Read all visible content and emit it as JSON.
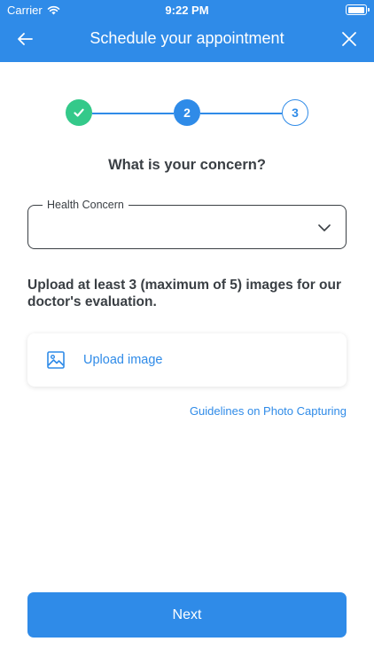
{
  "status_bar": {
    "carrier": "Carrier",
    "time": "9:22 PM",
    "battery_level": 1.0
  },
  "header": {
    "title": "Schedule your appointment",
    "back_icon": "arrow-left-icon",
    "close_icon": "close-icon",
    "background_color": "#2f8be8"
  },
  "stepper": {
    "steps": [
      {
        "label": "",
        "state": "completed",
        "icon": "checkmark-icon"
      },
      {
        "label": "2",
        "state": "current"
      },
      {
        "label": "3",
        "state": "upcoming"
      }
    ],
    "completed_color": "#34c98a",
    "active_color": "#2f8be8"
  },
  "question": "What is your concern?",
  "concern_field": {
    "label": "Health Concern",
    "value": "",
    "icon": "chevron-down-icon"
  },
  "upload": {
    "instructions": "Upload at least 3 (maximum of 5) images for our doctor's evaluation.",
    "button_label": "Upload image",
    "icon": "image-icon"
  },
  "guidelines_link": "Guidelines on Photo Capturing",
  "next_button": "Next"
}
